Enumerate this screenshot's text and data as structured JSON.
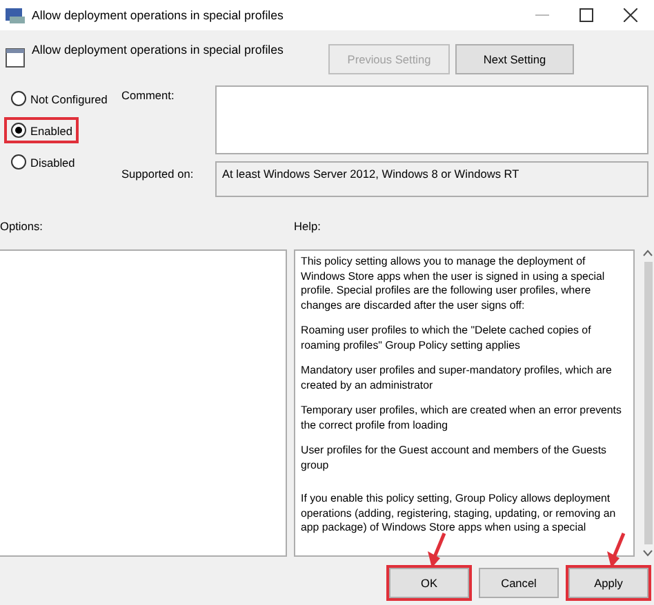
{
  "window": {
    "title": "Allow deployment operations in special profiles"
  },
  "header": {
    "title": "Allow deployment operations in special profiles"
  },
  "nav_buttons": [
    {
      "label": "Previous Setting",
      "disabled": true
    },
    {
      "label": "Next Setting",
      "disabled": false
    }
  ],
  "options": [
    {
      "label": "Not Configured",
      "selected": false,
      "highlighted": false
    },
    {
      "label": "Enabled",
      "selected": true,
      "highlighted": true
    },
    {
      "label": "Disabled",
      "selected": false,
      "highlighted": false
    }
  ],
  "comment": {
    "label": "Comment:"
  },
  "supported_on": {
    "label": "Supported on:",
    "value": "At least Windows Server 2012, Windows 8 or Windows RT"
  },
  "options_label": "Options:",
  "help_label": "Help:",
  "help_paragraphs": [
    "This policy setting allows you to manage the deployment of Windows Store apps when the user is signed in using a special profile. Special profiles are the following user profiles, where changes are discarded after the user signs off:",
    "Roaming user profiles to which the \"Delete cached copies of roaming profiles\" Group Policy setting applies",
    "Mandatory user profiles and super-mandatory profiles, which are created by an administrator",
    "Temporary user profiles, which are created when an error prevents the correct profile from loading",
    "User profiles for the Guest account and members of the Guests group",
    "If you enable this policy setting, Group Policy allows deployment operations (adding, registering, staging, updating, or removing an app package) of Windows Store apps when using a special"
  ],
  "buttons": [
    {
      "label": "OK",
      "highlighted": true
    },
    {
      "label": "Cancel",
      "highlighted": false
    },
    {
      "label": "Apply",
      "highlighted": true
    }
  ]
}
